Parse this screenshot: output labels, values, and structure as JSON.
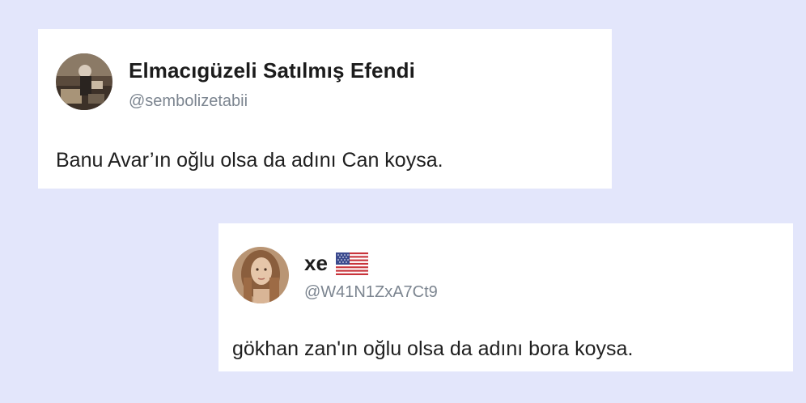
{
  "tweets": [
    {
      "display_name": "Elmacıgüzeli Satılmış Efendi",
      "handle": "@sembolizetabii",
      "text": "Banu Avar’ın oğlu olsa da adını Can koysa.",
      "avatar_icon": "user-avatar-icon",
      "badge_icon": null
    },
    {
      "display_name": "xe",
      "handle": "@W41N1ZxA7Ct9",
      "text": "gökhan zan'ın oğlu olsa da adını bora koysa.",
      "avatar_icon": "user-avatar-icon",
      "badge_icon": "us-flag-icon"
    }
  ],
  "colors": {
    "background": "#e3e6fb",
    "card": "#ffffff",
    "name": "#1c1c1c",
    "handle": "#7c8590",
    "text": "#1f1f1f"
  }
}
